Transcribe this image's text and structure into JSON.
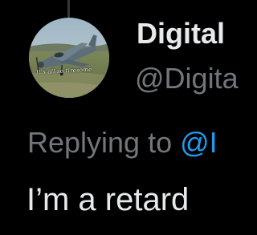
{
  "tweet": {
    "avatar_caption": "It's all so tiresome",
    "display_name": "Digital",
    "handle": "@Digita",
    "replying_prefix": "Replying to ",
    "replying_mention": "@I",
    "text": "I’m a retard"
  },
  "colors": {
    "background": "#000000",
    "primary_text": "#e7e9ea",
    "secondary_text": "#71767b",
    "accent": "#1d9bf0",
    "thread_line": "#333639"
  }
}
